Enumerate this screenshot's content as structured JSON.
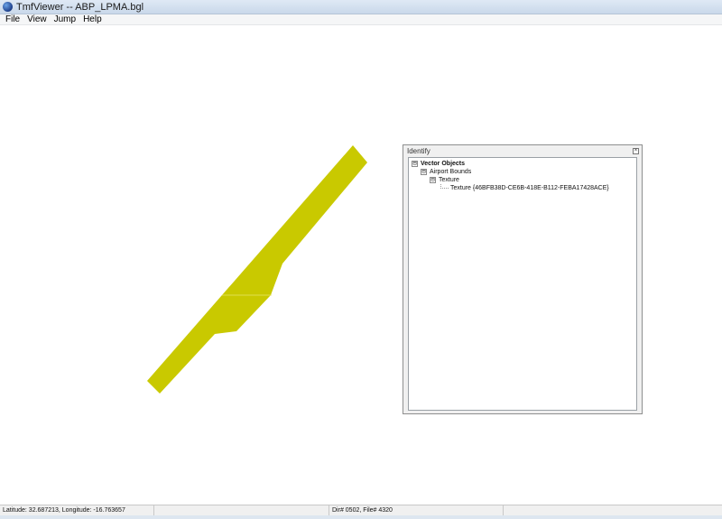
{
  "window": {
    "title": "TmfViewer -- ABP_LPMA.bgl",
    "icon": "globe-icon"
  },
  "menu": [
    "File",
    "View",
    "Jump",
    "Help"
  ],
  "identify": {
    "title": "Identify",
    "close_icon": "close-icon",
    "tree": {
      "root": {
        "expander": "⊟",
        "label": "Vector Objects"
      },
      "level1": {
        "expander": "⊟",
        "label": "Airport Bounds"
      },
      "level2": {
        "expander": "⊟",
        "label": "Texture"
      },
      "level3": {
        "label": "Texture {46BFB38D-CE6B-418E-B112-FEBA17428ACE}"
      }
    }
  },
  "map": {
    "polygon_color": "#c9c900",
    "shape": "airport-bounds-polygon"
  },
  "status": {
    "coords": "Latitude: 32.687213, Longitude: -16.763657",
    "empty": "",
    "dir_file": "Dir# 0502, File# 4320"
  }
}
